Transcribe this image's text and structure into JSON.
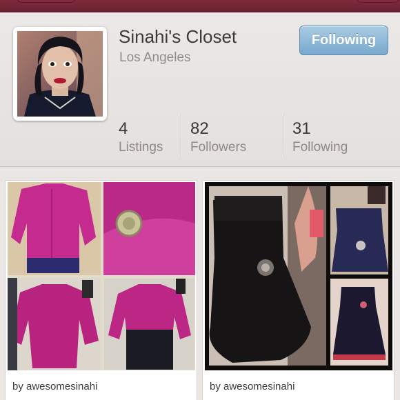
{
  "profile": {
    "name": "Sinahi's Closet",
    "location": "Los Angeles",
    "follow_button": "Following",
    "stats": [
      {
        "value": "4",
        "label": "Listings"
      },
      {
        "value": "82",
        "label": "Followers"
      },
      {
        "value": "31",
        "label": "Following"
      }
    ]
  },
  "listings": [
    {
      "byline": "by awesomesinahi"
    },
    {
      "byline": "by awesomesinahi"
    }
  ],
  "colors": {
    "topbar": "#7e2b3b",
    "follow_button": "#8fb9d9",
    "background": "#e3dfdd"
  }
}
